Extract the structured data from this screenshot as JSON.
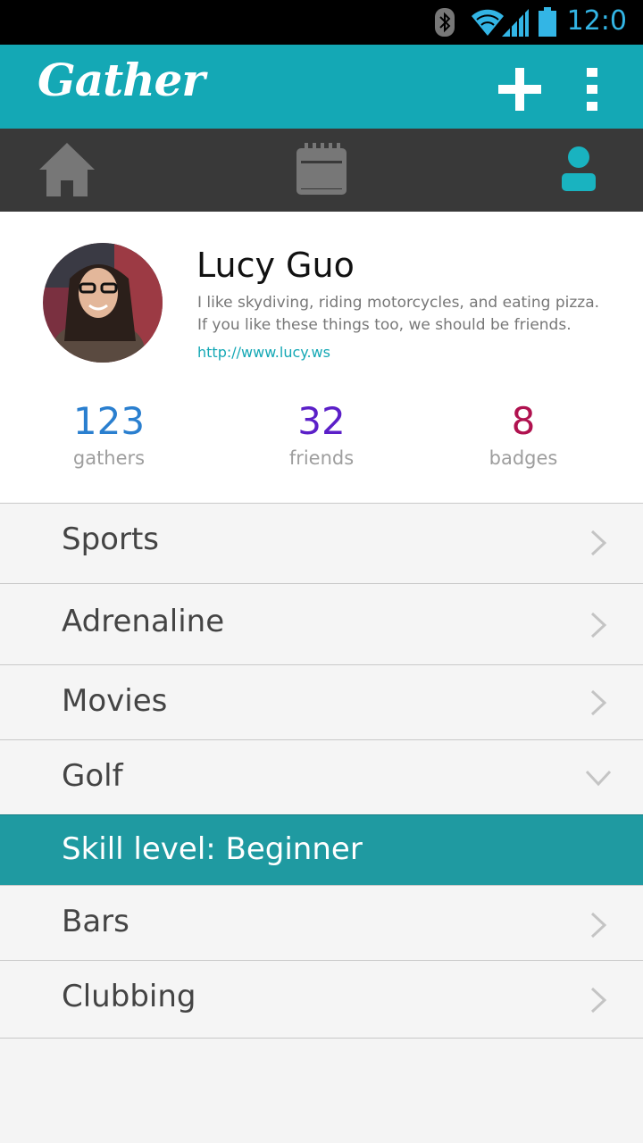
{
  "status_bar": {
    "time": "12:0",
    "icons": [
      "bluetooth-icon",
      "wifi-icon",
      "signal-icon",
      "battery-icon"
    ]
  },
  "app_bar": {
    "title": "Gather",
    "actions": [
      "add-icon",
      "overflow-menu-icon"
    ]
  },
  "nav": {
    "tabs": [
      "home-icon",
      "calendar-icon",
      "profile-icon"
    ],
    "active": "profile-icon"
  },
  "profile": {
    "name": "Lucy Guo",
    "bio": "I like skydiving, riding motorcycles, and eating pizza. If you like these things too, we should be friends.",
    "link": "http://www.lucy.ws",
    "stats": [
      {
        "value": "123",
        "label": "gathers",
        "color": "#2a7fcf"
      },
      {
        "value": "32",
        "label": "friends",
        "color": "#5b1fc8"
      },
      {
        "value": "8",
        "label": "badges",
        "color": "#b0124f"
      }
    ]
  },
  "categories": [
    {
      "label": "Sports",
      "state": "collapsed"
    },
    {
      "label": "Adrenaline",
      "state": "collapsed"
    },
    {
      "label": "Movies",
      "state": "collapsed"
    },
    {
      "label": "Golf",
      "state": "expanded"
    },
    {
      "label": "Bars",
      "state": "collapsed"
    },
    {
      "label": "Clubbing",
      "state": "collapsed"
    }
  ],
  "golf_detail": {
    "skill": "Skill level: Beginner"
  },
  "colors": {
    "primary": "#14a8b5",
    "skill_highlight": "#1f9aa1",
    "nav_background": "#393939"
  }
}
